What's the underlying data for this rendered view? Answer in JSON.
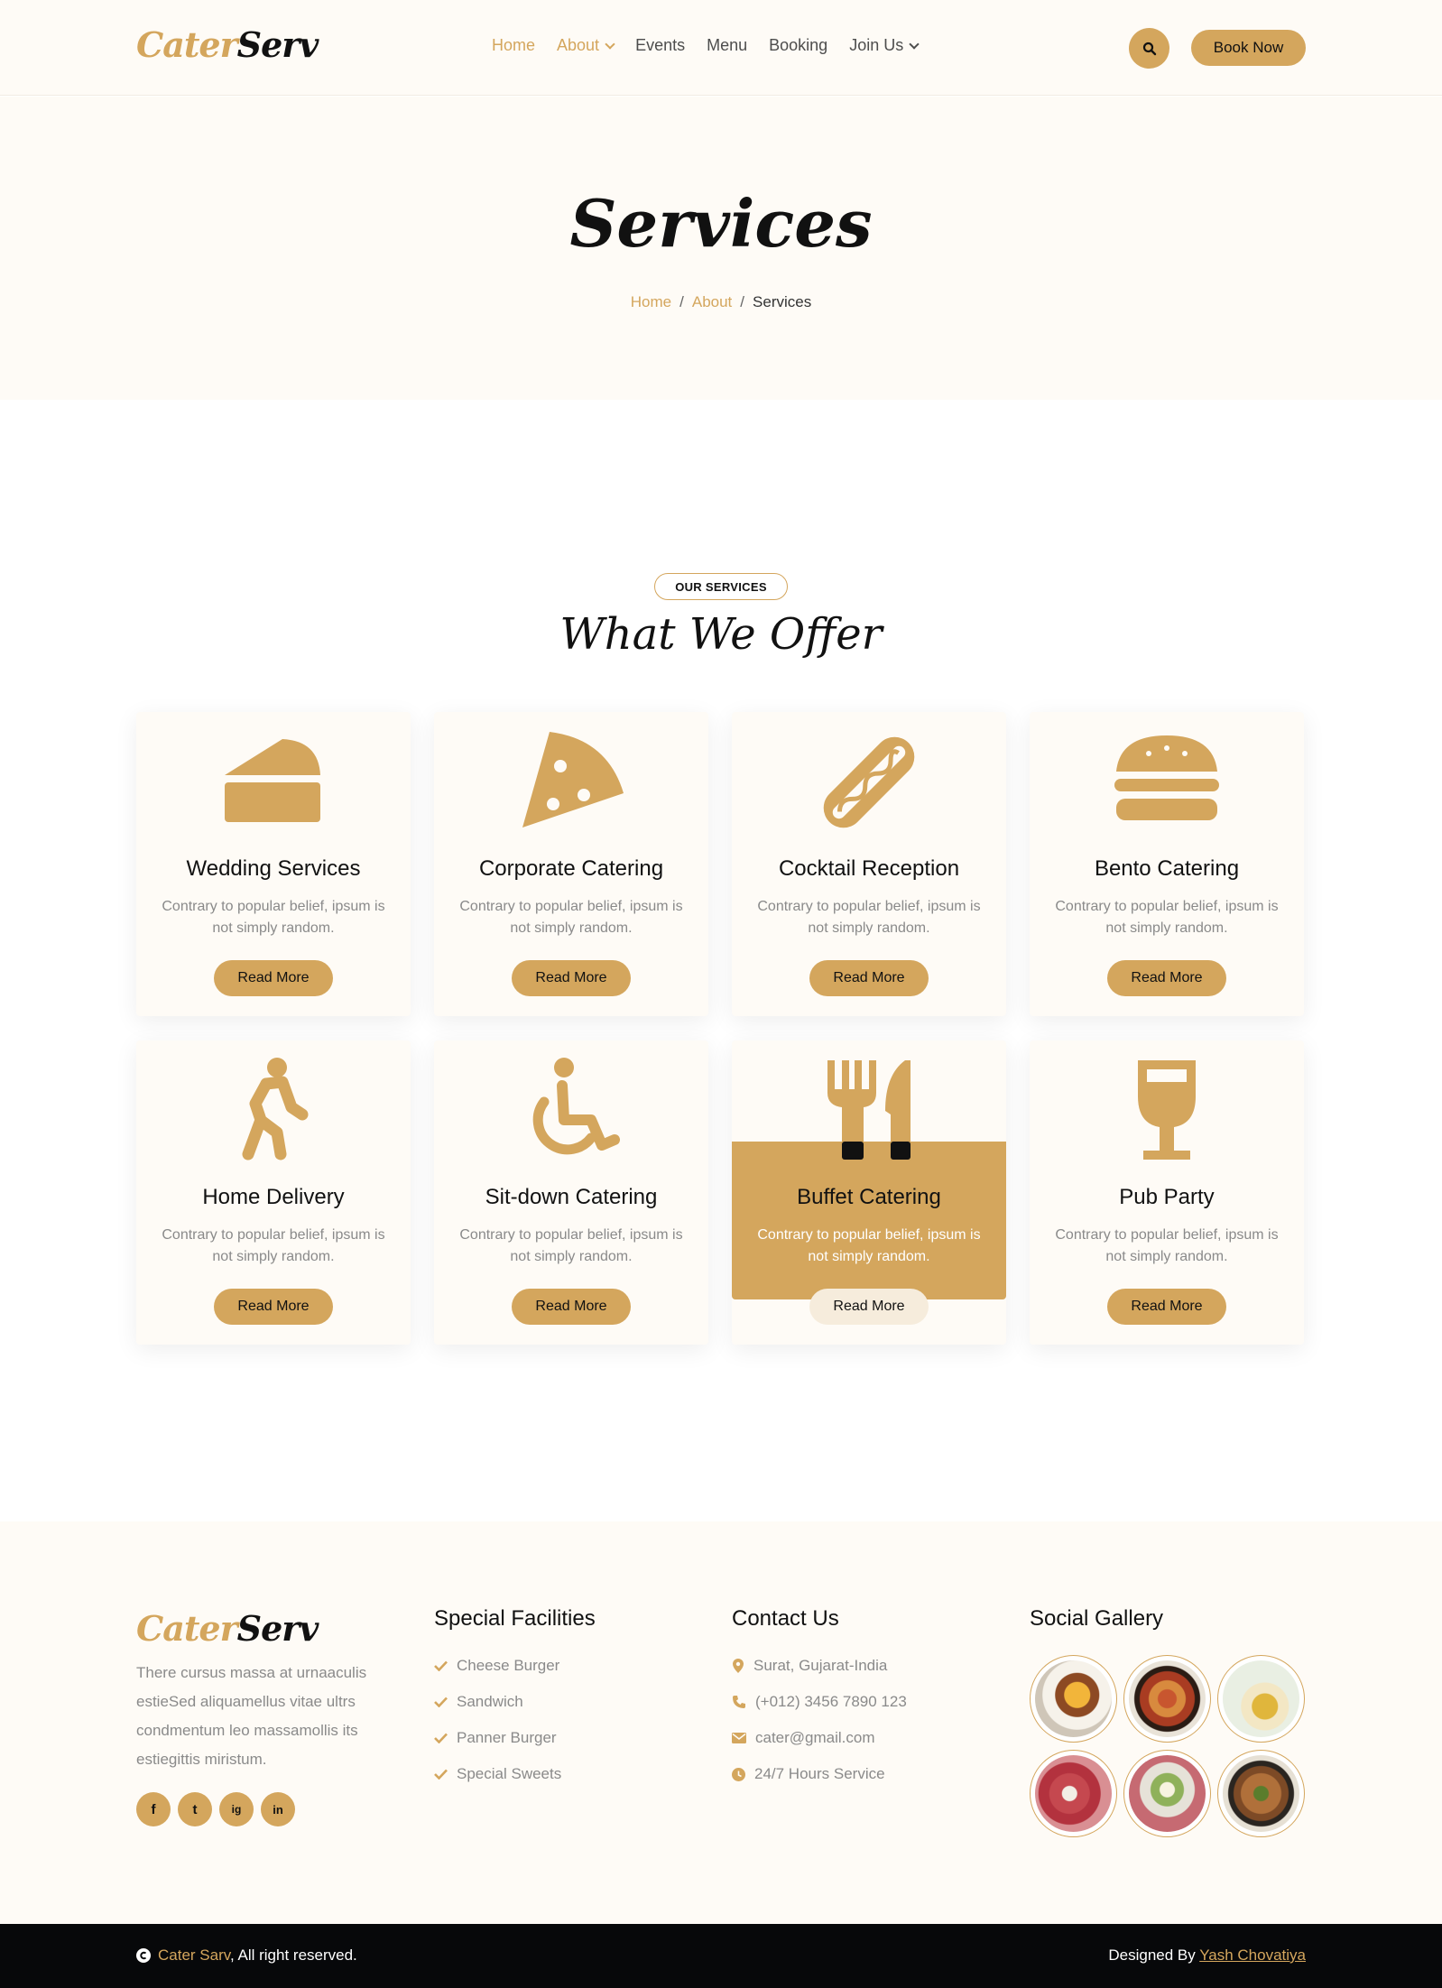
{
  "header": {
    "logo_part1": "Cater",
    "logo_part2": "Serv",
    "nav": [
      "Home",
      "About",
      "Events",
      "Menu",
      "Booking",
      "Join Us"
    ],
    "search_icon": "search-icon",
    "book_label": "Book Now"
  },
  "hero": {
    "title": "Services",
    "breadcrumb": [
      "Home",
      "About",
      "Services"
    ],
    "separator": "/"
  },
  "services": {
    "tag": "OUR SERVICES",
    "title": "What We Offer",
    "cards": [
      {
        "title": "Wedding Services",
        "desc": "Contrary to popular belief, ipsum is not simply random.",
        "button": "Read More",
        "icon": "cake-slice-icon"
      },
      {
        "title": "Corporate Catering",
        "desc": "Contrary to popular belief, ipsum is not simply random.",
        "button": "Read More",
        "icon": "pizza-slice-icon"
      },
      {
        "title": "Cocktail Reception",
        "desc": "Contrary to popular belief, ipsum is not simply random.",
        "button": "Read More",
        "icon": "hotdog-icon"
      },
      {
        "title": "Bento Catering",
        "desc": "Contrary to popular belief, ipsum is not simply random.",
        "button": "Read More",
        "icon": "burger-icon"
      },
      {
        "title": "Home Delivery",
        "desc": "Contrary to popular belief, ipsum is not simply random.",
        "button": "Read More",
        "icon": "walking-person-icon"
      },
      {
        "title": "Sit-down Catering",
        "desc": "Contrary to popular belief, ipsum is not simply random.",
        "button": "Read More",
        "icon": "wheelchair-icon"
      },
      {
        "title": "Buffet Catering",
        "desc": "Contrary to popular belief, ipsum is not simply random.",
        "button": "Read More",
        "icon": "utensils-icon"
      },
      {
        "title": "Pub Party",
        "desc": "Contrary to popular belief, ipsum is not simply random.",
        "button": "Read More",
        "icon": "wine-glass-icon"
      }
    ]
  },
  "footer": {
    "logo_part1": "Cater",
    "logo_part2": "Serv",
    "about": "There cursus massa at urnaaculis estieSed aliquamellus vitae ultrs condmentum leo massamollis its estiegittis miristum.",
    "social": [
      "f",
      "t",
      "ig",
      "in"
    ],
    "social_icons": [
      "facebook-icon",
      "twitter-icon",
      "instagram-icon",
      "linkedin-icon"
    ],
    "facilities_title": "Special Facilities",
    "facilities": [
      "Cheese Burger",
      "Sandwich",
      "Panner Burger",
      "Special Sweets"
    ],
    "contact_title": "Contact Us",
    "contact": [
      {
        "icon": "location-pin-icon",
        "text": "Surat, Gujarat-India"
      },
      {
        "icon": "phone-icon",
        "text": "(+012) 3456 7890 123"
      },
      {
        "icon": "envelope-icon",
        "text": "cater@gmail.com"
      },
      {
        "icon": "clock-icon",
        "text": "24/7 Hours Service"
      }
    ],
    "gallery_title": "Social Gallery",
    "gallery_count": 6
  },
  "bottom_bar": {
    "copyright_icon": "copyright-icon",
    "brand": "Cater Sarv",
    "rights": ", All right reserved.",
    "designed_by": "Designed By ",
    "designer": "Yash Chovatiya"
  },
  "colors": {
    "accent": "#d4a65d",
    "cream": "#fefbf6",
    "dark": "#07080a"
  }
}
